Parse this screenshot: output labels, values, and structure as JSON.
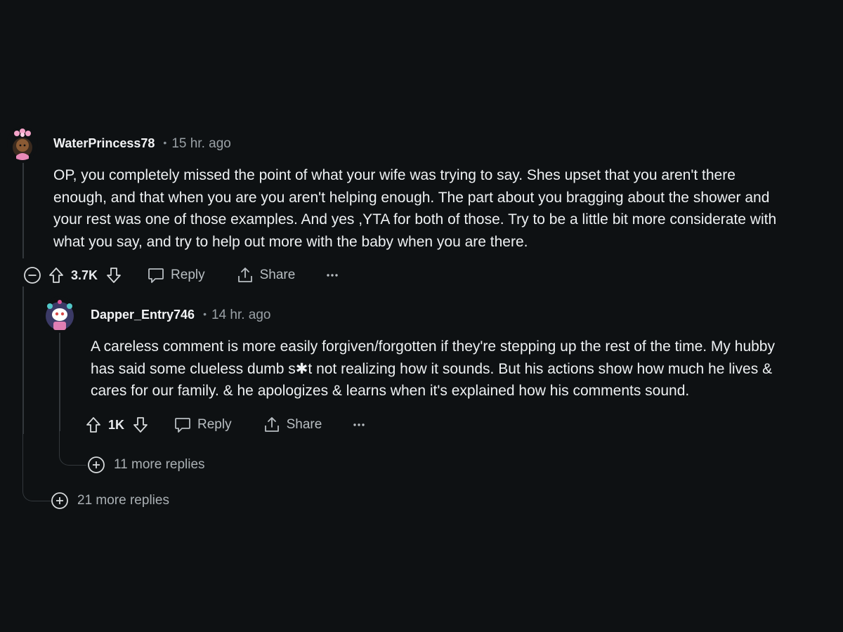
{
  "comment1": {
    "username": "WaterPrincess78",
    "separator": "•",
    "timestamp": "15 hr. ago",
    "body_lines": [
      "OP, you completely missed the point of what your wife was trying to say. Shes upset that you aren't there",
      "enough, and that when you are you aren't helping enough. The part about you bragging about the shower and",
      "your rest was one of those examples. And yes ,YTA for both of those. Try to be a little bit more considerate with",
      "what you say, and try to help out more with the baby when you are there."
    ],
    "score": "3.7K",
    "reply_label": "Reply",
    "share_label": "Share",
    "more_replies": "21 more replies"
  },
  "comment2": {
    "username": "Dapper_Entry746",
    "separator": "•",
    "timestamp": "14 hr. ago",
    "body_lines": [
      "A careless comment is more easily forgiven/forgotten if they're stepping up the rest of the time. My hubby",
      "has said some clueless dumb s✱t not realizing how it sounds. But his actions show how much he lives &",
      "cares for our family. & he apologizes & learns when it's explained how his comments sound."
    ],
    "score": "1K",
    "reply_label": "Reply",
    "share_label": "Share",
    "more_replies": "11 more replies"
  },
  "colors": {
    "background": "#0e1113",
    "thread_line": "#33383c",
    "text": "#eef1f3",
    "muted": "#9aa1a6"
  },
  "icons": [
    "collapse-icon",
    "upvote-icon",
    "downvote-icon",
    "reply-icon",
    "share-icon",
    "overflow-menu-icon",
    "expand-icon"
  ]
}
